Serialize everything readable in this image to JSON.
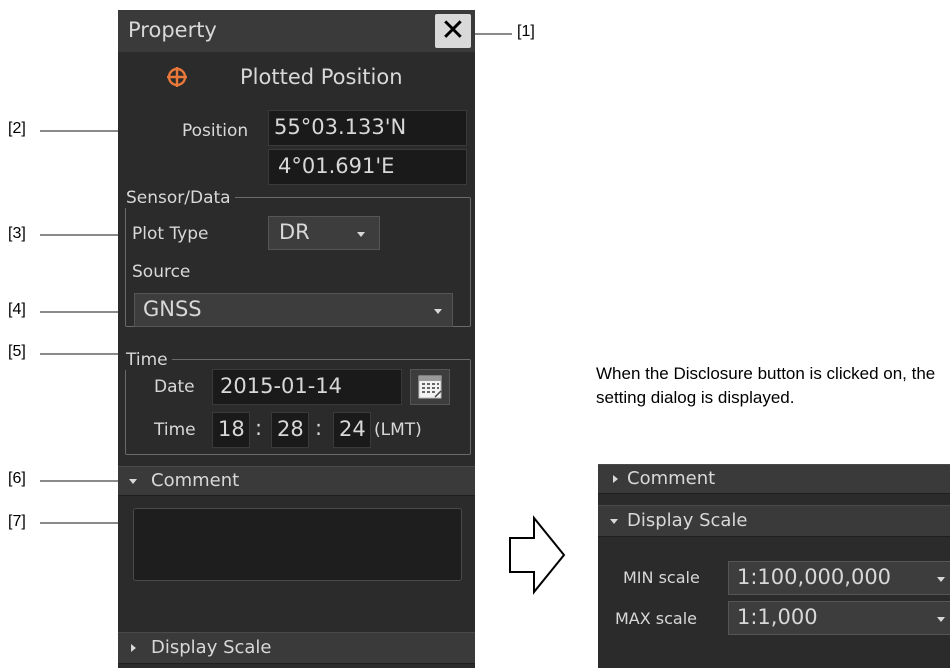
{
  "callouts": [
    "[1]",
    "[2]",
    "[3]",
    "[4]",
    "[5]",
    "[6]",
    "[7]"
  ],
  "panel": {
    "title": "Property",
    "close_icon": "close-x-icon",
    "object_icon": "plotted-position-crosshair-icon",
    "object_name": "Plotted Position",
    "position": {
      "label": "Position",
      "lat": "55°03.133'N",
      "lon": "4°01.691'E"
    },
    "sensor_group": {
      "title": "Sensor/Data",
      "plot_type_label": "Plot Type",
      "plot_type_value": "DR",
      "source_label": "Source",
      "source_value": "GNSS"
    },
    "time_group": {
      "title": "Time",
      "date_label": "Date",
      "date_value": "2015-01-14",
      "calendar_icon": "calendar-icon",
      "time_label": "Time",
      "hour": "18",
      "minute": "28",
      "second": "24",
      "separator": ":",
      "zone": "(LMT)"
    },
    "comment_section": "Comment",
    "display_scale_section": "Display Scale"
  },
  "transition_arrow_icon": "right-arrow-outline-icon",
  "note": "When the Disclosure button is clicked on, the setting dialog is displayed.",
  "expanded_panel": {
    "comment_section": "Comment",
    "display_scale_section": "Display Scale",
    "min_scale_label": "MIN scale",
    "min_scale_value": "1:100,000,000",
    "max_scale_label": "MAX scale",
    "max_scale_value": "1:1,000"
  },
  "colors": {
    "panel_bg": "#2b2b2b",
    "title_bar": "#3a3a3a",
    "text": "#d8d8d8",
    "accent_icon": "#e8773a",
    "callout_line": "#8a8a8a"
  }
}
